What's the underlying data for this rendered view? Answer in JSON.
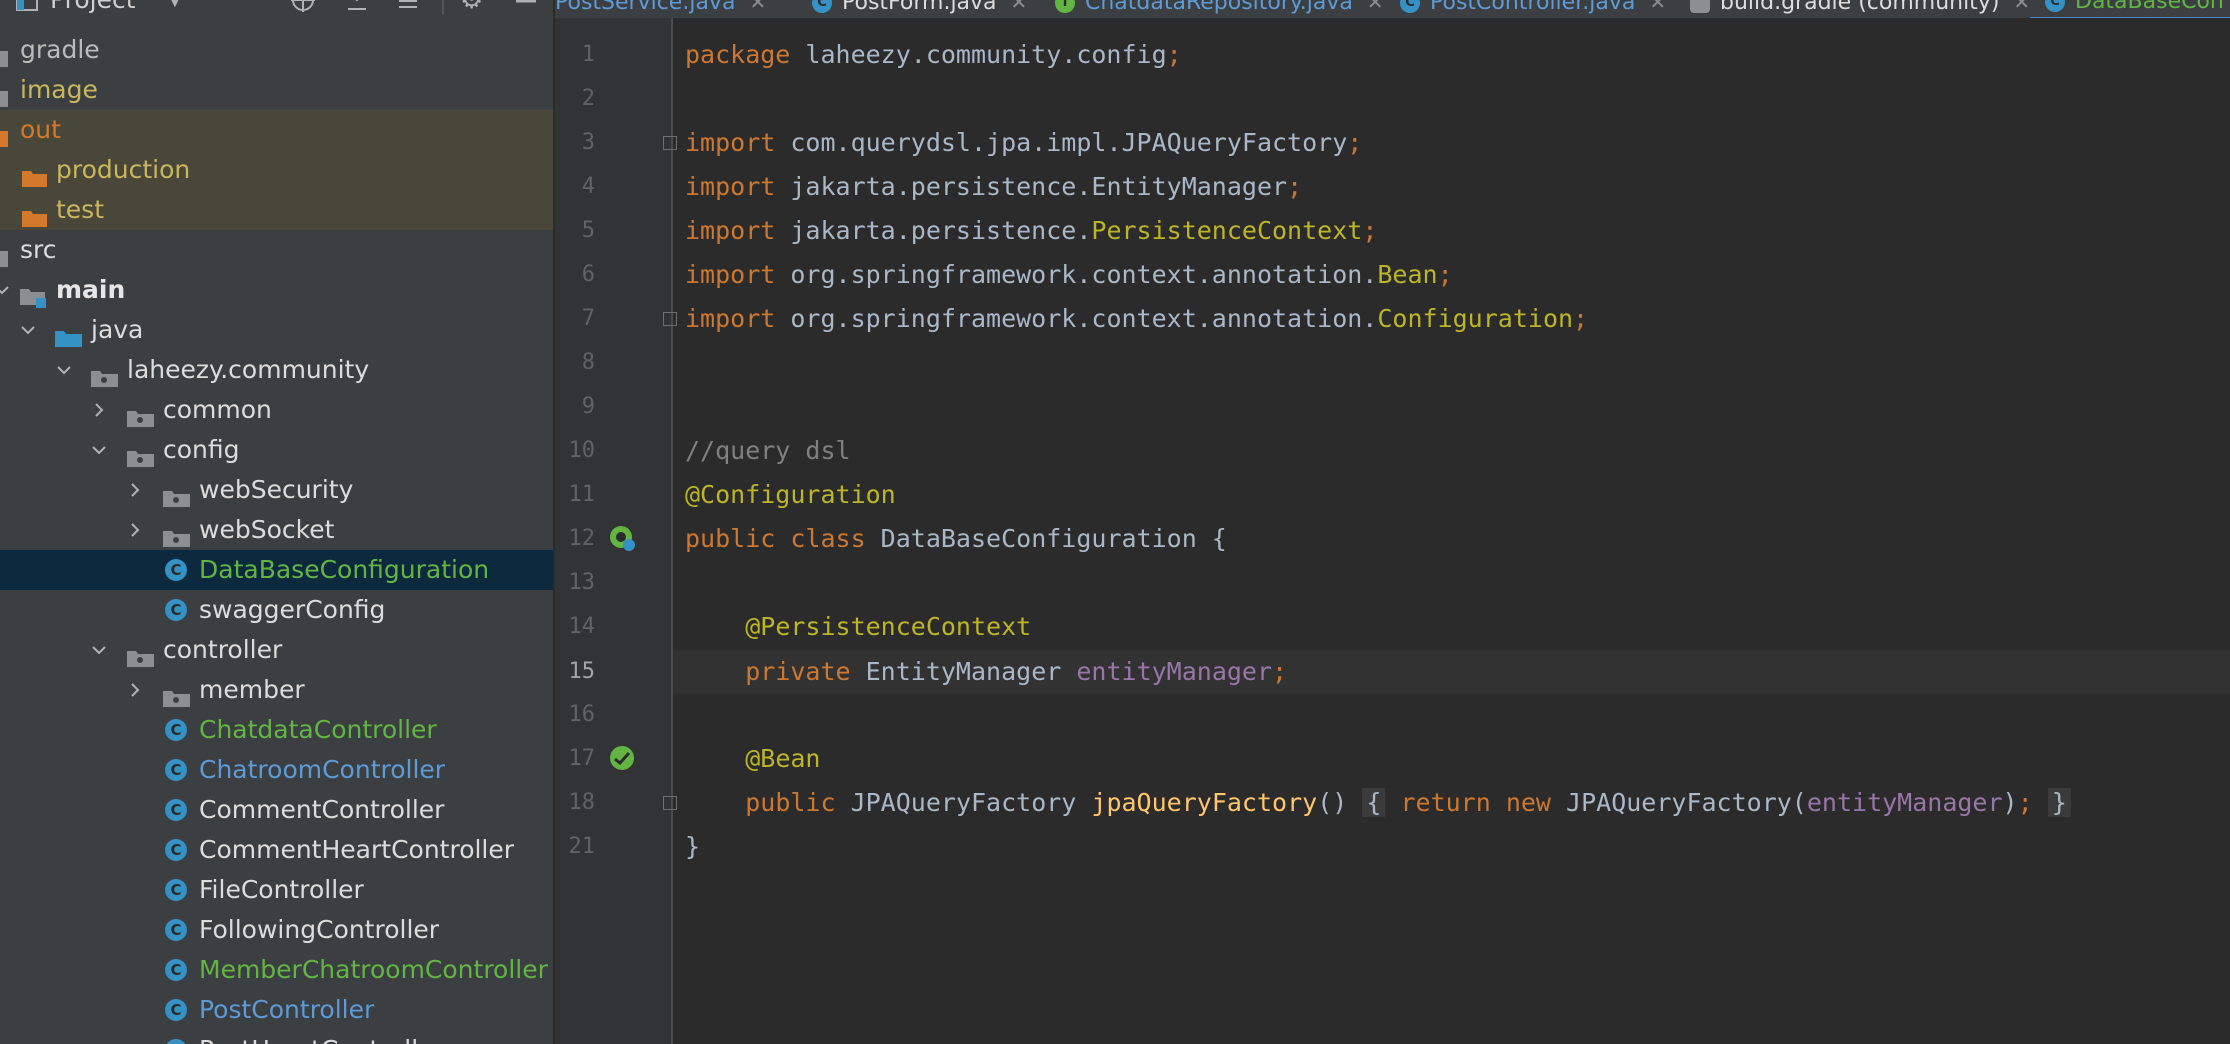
{
  "project_panel": {
    "title": "Project",
    "tree": [
      {
        "label": "gradle"
      },
      {
        "label": "image"
      },
      {
        "label": "out"
      },
      {
        "label": "production"
      },
      {
        "label": "test"
      },
      {
        "label": "src"
      },
      {
        "label": "main"
      },
      {
        "label": "java"
      },
      {
        "label": "laheezy.community"
      },
      {
        "label": "common"
      },
      {
        "label": "config"
      },
      {
        "label": "webSecurity"
      },
      {
        "label": "webSocket"
      },
      {
        "label": "DataBaseConfiguration"
      },
      {
        "label": "swaggerConfig"
      },
      {
        "label": "controller"
      },
      {
        "label": "member"
      },
      {
        "label": "ChatdataController"
      },
      {
        "label": "ChatroomController"
      },
      {
        "label": "CommentController"
      },
      {
        "label": "CommentHeartController"
      },
      {
        "label": "FileController"
      },
      {
        "label": "FollowingController"
      },
      {
        "label": "MemberChatroomController"
      },
      {
        "label": "PostController"
      },
      {
        "label": "PostHeartController"
      }
    ]
  },
  "tabs": [
    {
      "label": "PostService.java",
      "icon": "class-icon"
    },
    {
      "label": "PostForm.java",
      "icon": "class-icon"
    },
    {
      "label": "ChatdataRepository.java",
      "icon": "interface-icon"
    },
    {
      "label": "PostController.java",
      "icon": "class-icon"
    },
    {
      "label": "build.gradle (community)",
      "icon": "gradle-icon"
    },
    {
      "label": "DataBaseCon",
      "icon": "class-icon",
      "active": true
    }
  ],
  "editor": {
    "current_line": "15",
    "lines": [
      {
        "n": "1",
        "tokens": [
          {
            "t": "package",
            "c": "kw"
          },
          {
            "t": " laheezy.community.config"
          },
          {
            "t": ";",
            "c": "semi"
          }
        ]
      },
      {
        "n": "2",
        "tokens": []
      },
      {
        "n": "3",
        "tokens": [
          {
            "t": "import",
            "c": "kw"
          },
          {
            "t": " com.querydsl.jpa.impl.JPAQueryFactory"
          },
          {
            "t": ";",
            "c": "semi"
          }
        ]
      },
      {
        "n": "4",
        "tokens": [
          {
            "t": "import",
            "c": "kw"
          },
          {
            "t": " jakarta.persistence.EntityManager"
          },
          {
            "t": ";",
            "c": "semi"
          }
        ]
      },
      {
        "n": "5",
        "tokens": [
          {
            "t": "import",
            "c": "kw"
          },
          {
            "t": " jakarta.persistence."
          },
          {
            "t": "PersistenceContext",
            "c": "ann"
          },
          {
            "t": ";",
            "c": "semi"
          }
        ]
      },
      {
        "n": "6",
        "tokens": [
          {
            "t": "import",
            "c": "kw"
          },
          {
            "t": " org.springframework.context.annotation."
          },
          {
            "t": "Bean",
            "c": "ann"
          },
          {
            "t": ";",
            "c": "semi"
          }
        ]
      },
      {
        "n": "7",
        "tokens": [
          {
            "t": "import",
            "c": "kw"
          },
          {
            "t": " org.springframework.context.annotation."
          },
          {
            "t": "Configuration",
            "c": "ann"
          },
          {
            "t": ";",
            "c": "semi"
          }
        ]
      },
      {
        "n": "8",
        "tokens": []
      },
      {
        "n": "9",
        "tokens": []
      },
      {
        "n": "10",
        "tokens": [
          {
            "t": "//query dsl",
            "c": "cmt"
          }
        ]
      },
      {
        "n": "11",
        "tokens": [
          {
            "t": "@Configuration",
            "c": "ann"
          }
        ]
      },
      {
        "n": "12",
        "tokens": [
          {
            "t": "public class",
            "c": "kw"
          },
          {
            "t": " DataBaseConfiguration {"
          }
        ]
      },
      {
        "n": "13",
        "tokens": []
      },
      {
        "n": "14",
        "tokens": [
          {
            "t": "    "
          },
          {
            "t": "@PersistenceContext",
            "c": "ann"
          }
        ]
      },
      {
        "n": "15",
        "tokens": [
          {
            "t": "    "
          },
          {
            "t": "private",
            "c": "kw"
          },
          {
            "t": " EntityManager "
          },
          {
            "t": "entityManager",
            "c": "fld"
          },
          {
            "t": ";",
            "c": "semi"
          }
        ]
      },
      {
        "n": "16",
        "tokens": []
      },
      {
        "n": "17",
        "tokens": [
          {
            "t": "    "
          },
          {
            "t": "@Bean",
            "c": "ann"
          }
        ]
      },
      {
        "n": "18",
        "tokens": [
          {
            "t": "    "
          },
          {
            "t": "public",
            "c": "kw"
          },
          {
            "t": " JPAQueryFactory "
          },
          {
            "t": "jpaQueryFactory",
            "c": "fn"
          },
          {
            "t": "() "
          },
          {
            "t": "{",
            "c": "brc"
          },
          {
            "t": " "
          },
          {
            "t": "return new",
            "c": "kw"
          },
          {
            "t": " JPAQueryFactory("
          },
          {
            "t": "entityManager",
            "c": "fld"
          },
          {
            "t": ")"
          },
          {
            "t": ";",
            "c": "semi"
          },
          {
            "t": " "
          },
          {
            "t": "}",
            "c": "brc"
          }
        ]
      },
      {
        "n": "21",
        "tokens": [
          {
            "t": "}"
          }
        ]
      }
    ]
  },
  "colors": {
    "keyword": "#cc7832",
    "annotation": "#bbb529",
    "field": "#9876aa",
    "method": "#ffc66d",
    "comment": "#808080",
    "selection": "#0d293e"
  }
}
